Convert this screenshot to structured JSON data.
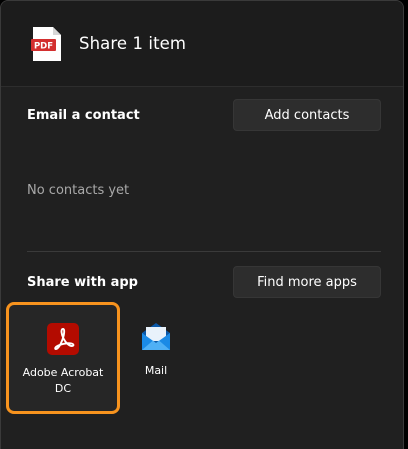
{
  "header": {
    "title": "Share 1 item",
    "file_icon": "pdf-file-icon",
    "file_badge": "PDF"
  },
  "email_section": {
    "label": "Email a contact",
    "button_label": "Add contacts",
    "empty_text": "No contacts yet"
  },
  "apps_section": {
    "label": "Share with app",
    "button_label": "Find more apps",
    "apps": [
      {
        "name": "Adobe Acrobat\nDC",
        "icon": "adobe-acrobat-icon",
        "selected": true
      },
      {
        "name": "Mail",
        "icon": "mail-icon",
        "selected": false
      }
    ]
  },
  "colors": {
    "background": "#202020",
    "selection_highlight": "#f7931e",
    "acrobat_red": "#b30b00",
    "mail_blue": "#0f78d4"
  }
}
